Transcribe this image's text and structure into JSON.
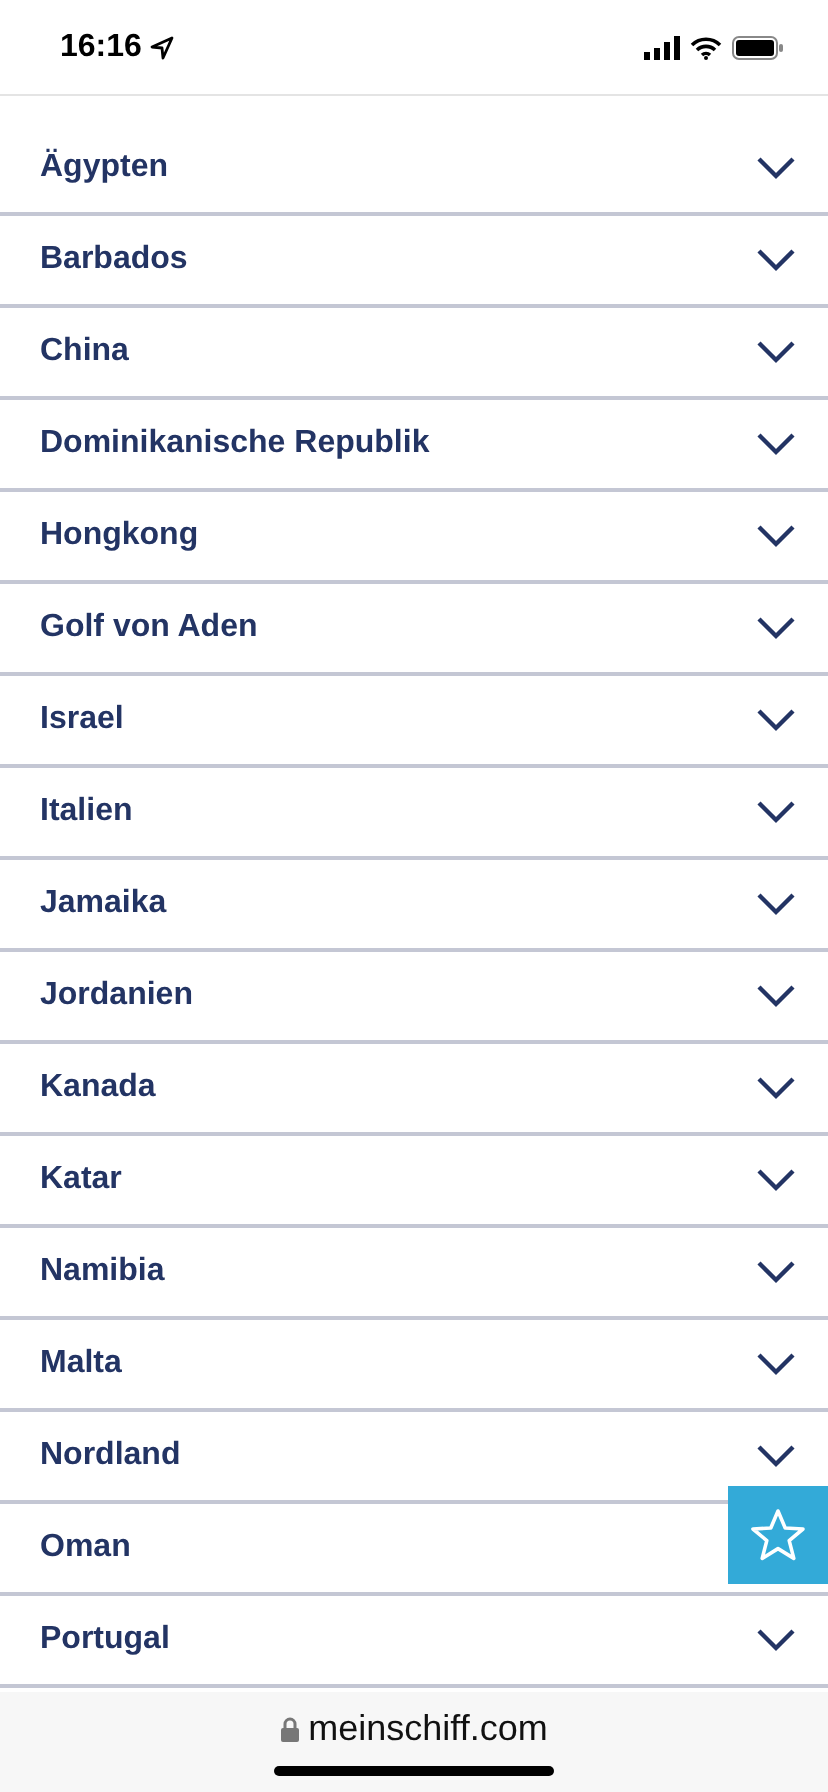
{
  "status_bar": {
    "time": "16:16"
  },
  "countries": [
    {
      "name": "Ägypten",
      "kind": "accordion"
    },
    {
      "name": "Barbados",
      "kind": "accordion"
    },
    {
      "name": "China",
      "kind": "accordion"
    },
    {
      "name": "Dominikanische Republik",
      "kind": "accordion"
    },
    {
      "name": "Hongkong",
      "kind": "accordion"
    },
    {
      "name": "Golf von Aden",
      "kind": "accordion"
    },
    {
      "name": "Israel",
      "kind": "accordion"
    },
    {
      "name": "Italien",
      "kind": "accordion"
    },
    {
      "name": "Jamaika",
      "kind": "accordion"
    },
    {
      "name": "Jordanien",
      "kind": "accordion"
    },
    {
      "name": "Kanada",
      "kind": "accordion"
    },
    {
      "name": "Katar",
      "kind": "accordion"
    },
    {
      "name": "Namibia",
      "kind": "accordion"
    },
    {
      "name": "Malta",
      "kind": "accordion"
    },
    {
      "name": "Nordland",
      "kind": "accordion"
    },
    {
      "name": "Oman",
      "kind": "favorite"
    },
    {
      "name": "Portugal",
      "kind": "accordion"
    }
  ],
  "browser_bar": {
    "url": "meinschiff.com"
  }
}
